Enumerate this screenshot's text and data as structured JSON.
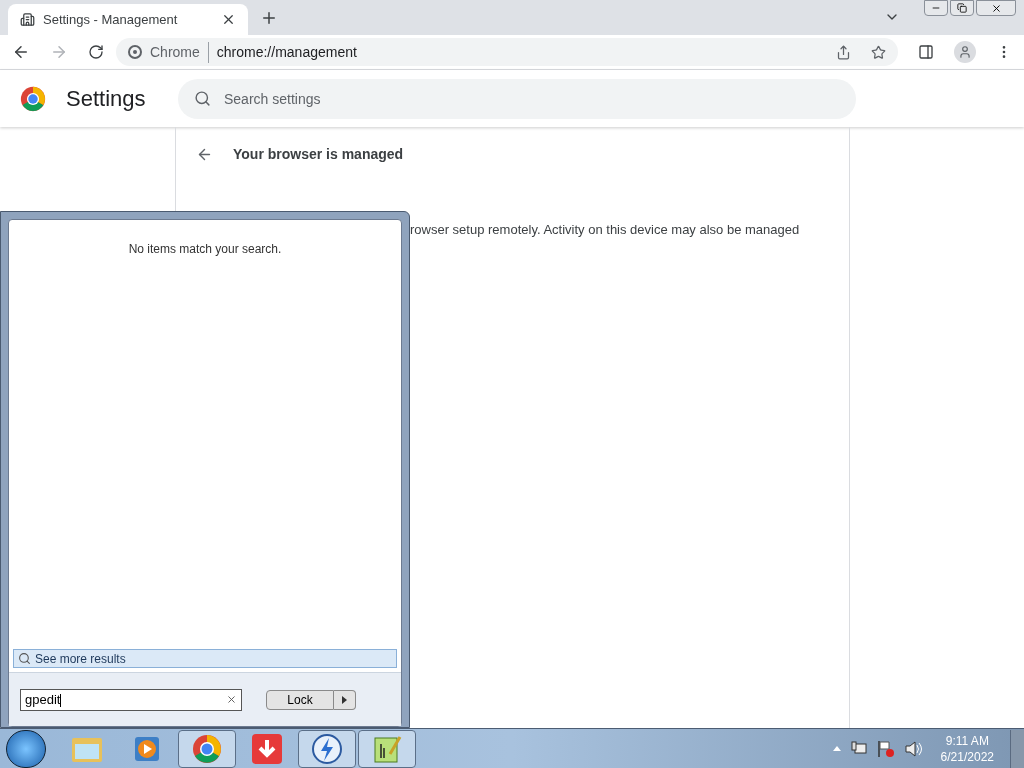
{
  "browser": {
    "tabs": [
      {
        "title": "Settings - Management",
        "selected": true
      }
    ],
    "omnibox": {
      "chip": "Chrome",
      "url": "chrome://management"
    }
  },
  "settings": {
    "title": "Settings",
    "search": {
      "placeholder": "Search settings"
    },
    "page_title": "Your browser is managed",
    "paragraph": "rowser setup remotely. Activity on this device may also be managed"
  },
  "start_menu": {
    "message": "No items match your search.",
    "see_more": "See more results",
    "search": {
      "value": "gpedit"
    },
    "power_button": "Lock"
  },
  "taskbar": {
    "items": [
      {
        "kind": "explorer",
        "active": false
      },
      {
        "kind": "media",
        "active": false
      },
      {
        "kind": "chrome",
        "active": true
      },
      {
        "kind": "download",
        "active": false
      },
      {
        "kind": "bolt",
        "active": true
      },
      {
        "kind": "notepad",
        "active": true
      }
    ],
    "time": "9:11 AM",
    "date": "6/21/2022"
  }
}
